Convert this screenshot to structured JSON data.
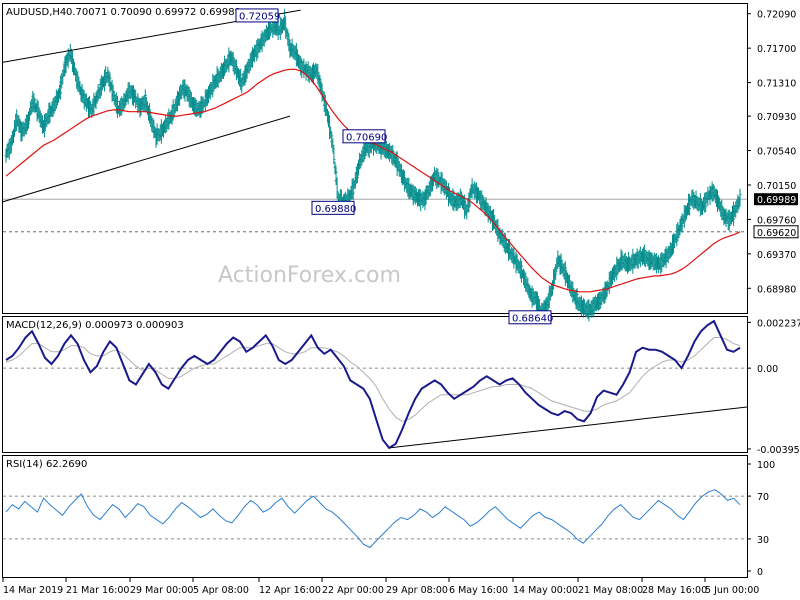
{
  "header": {
    "symbol": "AUDUSD,H4",
    "ohlc": "0.70071 0.70090 0.69972 0.69989"
  },
  "watermark": "ActionForex.com",
  "colors": {
    "bars": "#008b8b",
    "ma": "#e01010",
    "macd_main": "#1a1a8c",
    "macd_signal": "#b0b0b0",
    "rsi": "#2b7fd0",
    "trendline": "#000000",
    "box_border": "#000080",
    "box_text": "#000080",
    "dashed": "#555555"
  },
  "chart_data": [
    {
      "type": "line",
      "name": "price-panel",
      "ylim": [
        0.687,
        0.722
      ],
      "y_ticks": [
        "0.72090",
        "0.71700",
        "0.71310",
        "0.70930",
        "0.70540",
        "0.70150",
        "0.69760",
        "0.69370",
        "0.68980"
      ],
      "y_tick_values": [
        0.7209,
        0.717,
        0.7131,
        0.7093,
        0.7054,
        0.7015,
        0.6976,
        0.6937,
        0.6898
      ],
      "current_price_label": "0.69989",
      "current_price": 0.69989,
      "level_label": "0.69620",
      "level": 0.6962,
      "annotations": [
        {
          "label": "0.72059",
          "value": 0.72059,
          "bar": 50
        },
        {
          "label": "0.70690",
          "value": 0.7069,
          "bar": 62
        },
        {
          "label": "0.69880",
          "value": 0.6988,
          "bar": 64
        },
        {
          "label": "0.68640",
          "value": 0.6864,
          "bar": 100
        }
      ],
      "close": [
        0.705,
        0.7061,
        0.709,
        0.7075,
        0.7085,
        0.711,
        0.7098,
        0.708,
        0.7095,
        0.7105,
        0.712,
        0.715,
        0.7165,
        0.714,
        0.712,
        0.7108,
        0.71,
        0.7115,
        0.713,
        0.714,
        0.7118,
        0.71,
        0.7108,
        0.7122,
        0.7115,
        0.7103,
        0.711,
        0.709,
        0.707,
        0.7075,
        0.7085,
        0.7095,
        0.711,
        0.7125,
        0.7118,
        0.7105,
        0.71,
        0.7108,
        0.712,
        0.7132,
        0.714,
        0.715,
        0.716,
        0.7145,
        0.713,
        0.7145,
        0.716,
        0.717,
        0.718,
        0.719,
        0.7195,
        0.719,
        0.72,
        0.717,
        0.7165,
        0.715,
        0.7145,
        0.714,
        0.7145,
        0.712,
        0.7095,
        0.706,
        0.7,
        0.6995,
        0.7,
        0.7015,
        0.704,
        0.7055,
        0.706,
        0.7062,
        0.7058,
        0.7055,
        0.705,
        0.704,
        0.7025,
        0.7012,
        0.7005,
        0.7,
        0.6998,
        0.701,
        0.7025,
        0.702,
        0.7012,
        0.7,
        0.6995,
        0.7,
        0.6985,
        0.7012,
        0.7005,
        0.6995,
        0.6985,
        0.6975,
        0.696,
        0.695,
        0.694,
        0.693,
        0.692,
        0.6905,
        0.689,
        0.6885,
        0.687,
        0.688,
        0.69,
        0.693,
        0.692,
        0.6905,
        0.689,
        0.688,
        0.6875,
        0.6873,
        0.688,
        0.6885,
        0.6895,
        0.691,
        0.692,
        0.693,
        0.6925,
        0.6928,
        0.6932,
        0.6935,
        0.693,
        0.6928,
        0.6925,
        0.6932,
        0.694,
        0.6955,
        0.697,
        0.6985,
        0.7,
        0.6995,
        0.699,
        0.7002,
        0.7008,
        0.6995,
        0.698,
        0.6975,
        0.6985,
        0.6999
      ],
      "ma": [
        0.7025,
        0.703,
        0.7035,
        0.704,
        0.7045,
        0.705,
        0.7055,
        0.706,
        0.7063,
        0.7066,
        0.707,
        0.7074,
        0.7078,
        0.7082,
        0.7086,
        0.709,
        0.7093,
        0.7095,
        0.7097,
        0.7099,
        0.71,
        0.71,
        0.7099,
        0.7098,
        0.7098,
        0.7098,
        0.7098,
        0.7097,
        0.7096,
        0.7095,
        0.7094,
        0.7093,
        0.7093,
        0.7094,
        0.7095,
        0.7096,
        0.7097,
        0.7098,
        0.71,
        0.7102,
        0.7105,
        0.7108,
        0.7111,
        0.7114,
        0.7117,
        0.712,
        0.7125,
        0.713,
        0.7134,
        0.7138,
        0.7141,
        0.7143,
        0.7145,
        0.7146,
        0.7146,
        0.7144,
        0.714,
        0.7134,
        0.7126,
        0.7117,
        0.7107,
        0.7098,
        0.709,
        0.7083,
        0.7077,
        0.7072,
        0.7068,
        0.7065,
        0.7063,
        0.7061,
        0.7058,
        0.7055,
        0.7052,
        0.7048,
        0.7044,
        0.704,
        0.7036,
        0.7032,
        0.7028,
        0.7024,
        0.702,
        0.7016,
        0.7012,
        0.7008,
        0.7005,
        0.7002,
        0.6999,
        0.6995,
        0.699,
        0.6985,
        0.6979,
        0.6972,
        0.6965,
        0.6957,
        0.695,
        0.6943,
        0.6936,
        0.6929,
        0.6922,
        0.6916,
        0.691,
        0.6906,
        0.6902,
        0.69,
        0.6898,
        0.6896,
        0.6895,
        0.6894,
        0.6894,
        0.6894,
        0.6895,
        0.6896,
        0.6897,
        0.6899,
        0.6901,
        0.6903,
        0.6905,
        0.6907,
        0.6909,
        0.691,
        0.6911,
        0.6912,
        0.6912,
        0.6913,
        0.6914,
        0.6916,
        0.6919,
        0.6923,
        0.6928,
        0.6933,
        0.6938,
        0.6943,
        0.6948,
        0.6952,
        0.6955,
        0.6957,
        0.6959,
        0.6962
      ]
    },
    {
      "type": "line",
      "name": "macd-panel",
      "title": "MACD(12,26,9) 0.000973 0.000903",
      "ylim": [
        -0.0041,
        0.0025
      ],
      "y_ticks": [
        "0.002237",
        "0.00",
        "-0.00395"
      ],
      "y_tick_values": [
        0.002237,
        0.0,
        -0.00395
      ],
      "main": [
        0.0004,
        0.0006,
        0.001,
        0.0015,
        0.0018,
        0.0012,
        0.0005,
        0.0002,
        0.0006,
        0.0012,
        0.0016,
        0.0012,
        0.0004,
        -0.0002,
        0.0001,
        0.0008,
        0.0013,
        0.001,
        0.0002,
        -0.0006,
        -0.0008,
        -0.0003,
        0.0002,
        -0.0002,
        -0.0008,
        -0.001,
        -0.0005,
        0.0,
        0.0004,
        0.0006,
        0.0004,
        0.0002,
        0.0004,
        0.0008,
        0.0012,
        0.0015,
        0.0013,
        0.0008,
        0.001,
        0.0013,
        0.0016,
        0.0011,
        0.0004,
        0.0002,
        0.0004,
        0.0008,
        0.0012,
        0.0016,
        0.001,
        0.0007,
        0.0009,
        0.0005,
        0.0001,
        -0.0006,
        -0.0008,
        -0.001,
        -0.0015,
        -0.0025,
        -0.0035,
        -0.0039,
        -0.0037,
        -0.003,
        -0.0022,
        -0.0015,
        -0.001,
        -0.0008,
        -0.0006,
        -0.0008,
        -0.0012,
        -0.0015,
        -0.0013,
        -0.0011,
        -0.0009,
        -0.0006,
        -0.0004,
        -0.0006,
        -0.0008,
        -0.0006,
        -0.0005,
        -0.0008,
        -0.0012,
        -0.0015,
        -0.0018,
        -0.002,
        -0.0022,
        -0.0023,
        -0.0021,
        -0.0022,
        -0.0025,
        -0.0026,
        -0.0022,
        -0.0014,
        -0.0011,
        -0.0012,
        -0.0013,
        -0.0008,
        -0.0002,
        0.0008,
        0.001,
        0.0009,
        0.0009,
        0.0008,
        0.0006,
        0.0004,
        0.0,
        0.0006,
        0.0013,
        0.0018,
        0.0021,
        0.0023,
        0.0016,
        0.0009,
        0.0008,
        0.001
      ],
      "signal": [
        0.0003,
        0.0004,
        0.0006,
        0.0009,
        0.0012,
        0.0012,
        0.001,
        0.0008,
        0.0008,
        0.0009,
        0.0011,
        0.0011,
        0.001,
        0.0007,
        0.0006,
        0.0006,
        0.0008,
        0.0009,
        0.0007,
        0.0004,
        0.0001,
        -0.0001,
        0.0,
        -0.0001,
        -0.0003,
        -0.0005,
        -0.0005,
        -0.0004,
        -0.0002,
        0.0,
        0.0001,
        0.0002,
        0.0002,
        0.0004,
        0.0006,
        0.0008,
        0.001,
        0.001,
        0.001,
        0.0011,
        0.0012,
        0.0012,
        0.001,
        0.0008,
        0.0007,
        0.0007,
        0.0008,
        0.001,
        0.001,
        0.001,
        0.0009,
        0.0008,
        0.0006,
        0.0003,
        0.0001,
        -0.0002,
        -0.0005,
        -0.0009,
        -0.0015,
        -0.002,
        -0.0024,
        -0.0026,
        -0.0025,
        -0.0023,
        -0.002,
        -0.0017,
        -0.0015,
        -0.0013,
        -0.0013,
        -0.0013,
        -0.0013,
        -0.0013,
        -0.0012,
        -0.0011,
        -0.001,
        -0.0009,
        -0.0009,
        -0.0008,
        -0.0008,
        -0.0008,
        -0.0009,
        -0.001,
        -0.0012,
        -0.0014,
        -0.0016,
        -0.0017,
        -0.0018,
        -0.0019,
        -0.002,
        -0.0021,
        -0.0021,
        -0.002,
        -0.0018,
        -0.0017,
        -0.0016,
        -0.0014,
        -0.0012,
        -0.0008,
        -0.0004,
        -0.0001,
        0.0001,
        0.0003,
        0.0004,
        0.0004,
        0.0003,
        0.0004,
        0.0006,
        0.0009,
        0.0012,
        0.0015,
        0.0015,
        0.0014,
        0.0012,
        0.0011
      ]
    },
    {
      "type": "line",
      "name": "rsi-panel",
      "title": "RSI(14) 62.2690",
      "ylim": [
        0,
        100
      ],
      "y_ticks": [
        "100",
        "70",
        "30",
        "0"
      ],
      "y_tick_values": [
        100,
        70,
        30,
        0
      ],
      "values": [
        55,
        62,
        58,
        65,
        60,
        55,
        68,
        62,
        57,
        52,
        60,
        66,
        72,
        60,
        52,
        48,
        55,
        62,
        58,
        50,
        56,
        63,
        60,
        52,
        48,
        44,
        50,
        58,
        64,
        60,
        55,
        50,
        53,
        58,
        52,
        47,
        45,
        52,
        60,
        66,
        62,
        55,
        58,
        64,
        68,
        60,
        54,
        60,
        66,
        70,
        64,
        58,
        55,
        50,
        44,
        38,
        32,
        25,
        22,
        28,
        34,
        40,
        46,
        50,
        48,
        52,
        58,
        55,
        50,
        54,
        60,
        56,
        52,
        48,
        42,
        45,
        50,
        56,
        60,
        54,
        48,
        44,
        40,
        46,
        52,
        55,
        50,
        48,
        44,
        40,
        36,
        30,
        26,
        32,
        38,
        44,
        52,
        58,
        62,
        56,
        50,
        48,
        54,
        60,
        66,
        62,
        58,
        52,
        48,
        56,
        64,
        70,
        74,
        76,
        72,
        66,
        68,
        62
      ]
    }
  ],
  "x_axis": {
    "labels": [
      "14 Mar 2019",
      "21 Mar 16:00",
      "29 Mar 00:00",
      "5 Apr 08:00",
      "12 Apr 16:00",
      "22 Apr 00:00",
      "29 Apr 08:00",
      "6 May 16:00",
      "14 May 00:00",
      "21 May 08:00",
      "28 May 16:00",
      "5 Jun 00:00"
    ]
  }
}
